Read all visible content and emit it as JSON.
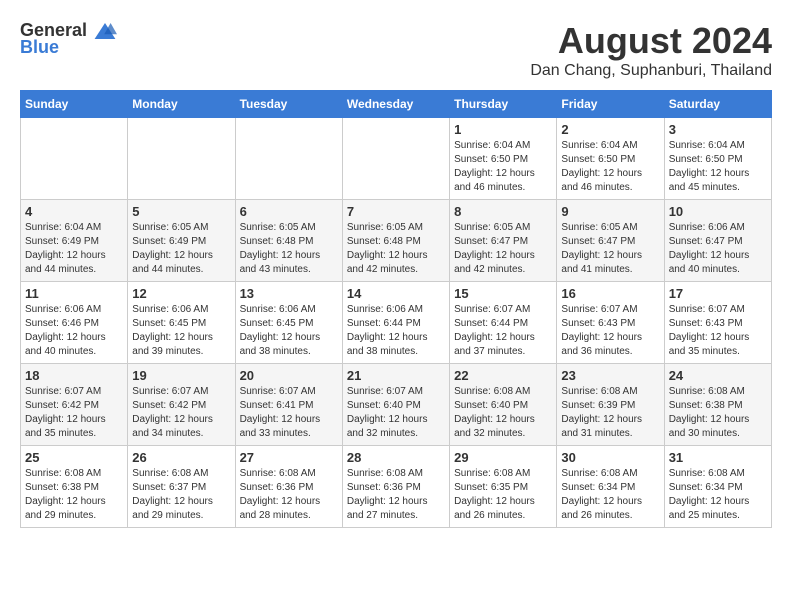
{
  "logo": {
    "general": "General",
    "blue": "Blue"
  },
  "title": {
    "month_year": "August 2024",
    "location": "Dan Chang, Suphanburi, Thailand"
  },
  "days_of_week": [
    "Sunday",
    "Monday",
    "Tuesday",
    "Wednesday",
    "Thursday",
    "Friday",
    "Saturday"
  ],
  "weeks": [
    [
      {
        "day": "",
        "info": ""
      },
      {
        "day": "",
        "info": ""
      },
      {
        "day": "",
        "info": ""
      },
      {
        "day": "",
        "info": ""
      },
      {
        "day": "1",
        "info": "Sunrise: 6:04 AM\nSunset: 6:50 PM\nDaylight: 12 hours\nand 46 minutes."
      },
      {
        "day": "2",
        "info": "Sunrise: 6:04 AM\nSunset: 6:50 PM\nDaylight: 12 hours\nand 46 minutes."
      },
      {
        "day": "3",
        "info": "Sunrise: 6:04 AM\nSunset: 6:50 PM\nDaylight: 12 hours\nand 45 minutes."
      }
    ],
    [
      {
        "day": "4",
        "info": "Sunrise: 6:04 AM\nSunset: 6:49 PM\nDaylight: 12 hours\nand 44 minutes."
      },
      {
        "day": "5",
        "info": "Sunrise: 6:05 AM\nSunset: 6:49 PM\nDaylight: 12 hours\nand 44 minutes."
      },
      {
        "day": "6",
        "info": "Sunrise: 6:05 AM\nSunset: 6:48 PM\nDaylight: 12 hours\nand 43 minutes."
      },
      {
        "day": "7",
        "info": "Sunrise: 6:05 AM\nSunset: 6:48 PM\nDaylight: 12 hours\nand 42 minutes."
      },
      {
        "day": "8",
        "info": "Sunrise: 6:05 AM\nSunset: 6:47 PM\nDaylight: 12 hours\nand 42 minutes."
      },
      {
        "day": "9",
        "info": "Sunrise: 6:05 AM\nSunset: 6:47 PM\nDaylight: 12 hours\nand 41 minutes."
      },
      {
        "day": "10",
        "info": "Sunrise: 6:06 AM\nSunset: 6:47 PM\nDaylight: 12 hours\nand 40 minutes."
      }
    ],
    [
      {
        "day": "11",
        "info": "Sunrise: 6:06 AM\nSunset: 6:46 PM\nDaylight: 12 hours\nand 40 minutes."
      },
      {
        "day": "12",
        "info": "Sunrise: 6:06 AM\nSunset: 6:45 PM\nDaylight: 12 hours\nand 39 minutes."
      },
      {
        "day": "13",
        "info": "Sunrise: 6:06 AM\nSunset: 6:45 PM\nDaylight: 12 hours\nand 38 minutes."
      },
      {
        "day": "14",
        "info": "Sunrise: 6:06 AM\nSunset: 6:44 PM\nDaylight: 12 hours\nand 38 minutes."
      },
      {
        "day": "15",
        "info": "Sunrise: 6:07 AM\nSunset: 6:44 PM\nDaylight: 12 hours\nand 37 minutes."
      },
      {
        "day": "16",
        "info": "Sunrise: 6:07 AM\nSunset: 6:43 PM\nDaylight: 12 hours\nand 36 minutes."
      },
      {
        "day": "17",
        "info": "Sunrise: 6:07 AM\nSunset: 6:43 PM\nDaylight: 12 hours\nand 35 minutes."
      }
    ],
    [
      {
        "day": "18",
        "info": "Sunrise: 6:07 AM\nSunset: 6:42 PM\nDaylight: 12 hours\nand 35 minutes."
      },
      {
        "day": "19",
        "info": "Sunrise: 6:07 AM\nSunset: 6:42 PM\nDaylight: 12 hours\nand 34 minutes."
      },
      {
        "day": "20",
        "info": "Sunrise: 6:07 AM\nSunset: 6:41 PM\nDaylight: 12 hours\nand 33 minutes."
      },
      {
        "day": "21",
        "info": "Sunrise: 6:07 AM\nSunset: 6:40 PM\nDaylight: 12 hours\nand 32 minutes."
      },
      {
        "day": "22",
        "info": "Sunrise: 6:08 AM\nSunset: 6:40 PM\nDaylight: 12 hours\nand 32 minutes."
      },
      {
        "day": "23",
        "info": "Sunrise: 6:08 AM\nSunset: 6:39 PM\nDaylight: 12 hours\nand 31 minutes."
      },
      {
        "day": "24",
        "info": "Sunrise: 6:08 AM\nSunset: 6:38 PM\nDaylight: 12 hours\nand 30 minutes."
      }
    ],
    [
      {
        "day": "25",
        "info": "Sunrise: 6:08 AM\nSunset: 6:38 PM\nDaylight: 12 hours\nand 29 minutes."
      },
      {
        "day": "26",
        "info": "Sunrise: 6:08 AM\nSunset: 6:37 PM\nDaylight: 12 hours\nand 29 minutes."
      },
      {
        "day": "27",
        "info": "Sunrise: 6:08 AM\nSunset: 6:36 PM\nDaylight: 12 hours\nand 28 minutes."
      },
      {
        "day": "28",
        "info": "Sunrise: 6:08 AM\nSunset: 6:36 PM\nDaylight: 12 hours\nand 27 minutes."
      },
      {
        "day": "29",
        "info": "Sunrise: 6:08 AM\nSunset: 6:35 PM\nDaylight: 12 hours\nand 26 minutes."
      },
      {
        "day": "30",
        "info": "Sunrise: 6:08 AM\nSunset: 6:34 PM\nDaylight: 12 hours\nand 26 minutes."
      },
      {
        "day": "31",
        "info": "Sunrise: 6:08 AM\nSunset: 6:34 PM\nDaylight: 12 hours\nand 25 minutes."
      }
    ]
  ]
}
